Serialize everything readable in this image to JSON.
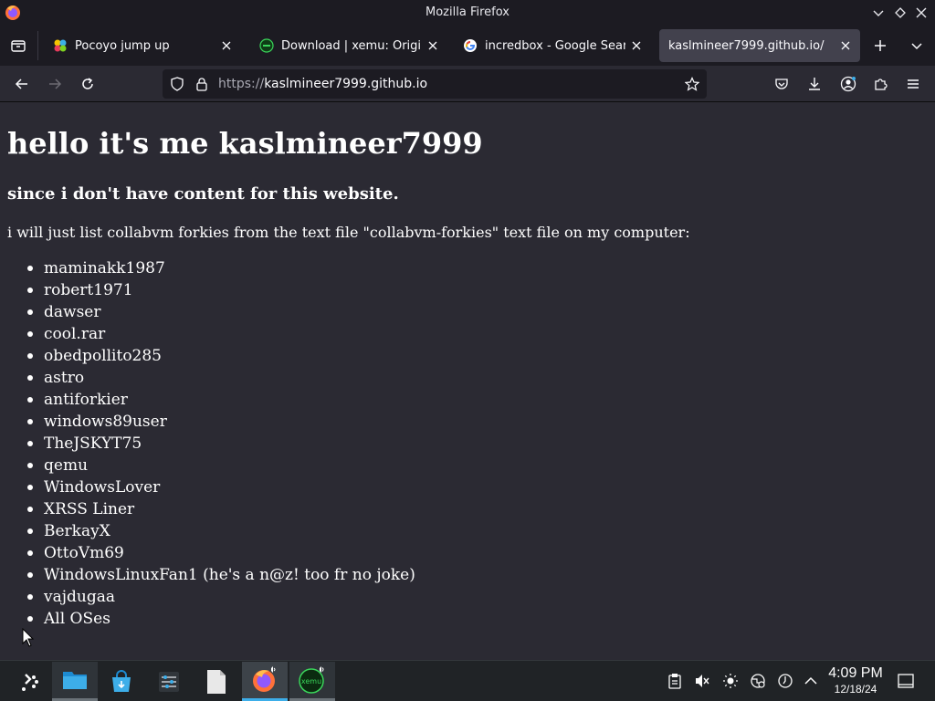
{
  "window": {
    "title": "Mozilla Firefox"
  },
  "tabs": [
    {
      "label": "Pocoyo jump up",
      "favicon": "pocoyo-favicon",
      "active": false
    },
    {
      "label": "Download | xemu: Original",
      "favicon": "xemu-favicon",
      "active": false
    },
    {
      "label": "incredbox - Google Search",
      "favicon": "google-favicon",
      "active": false
    },
    {
      "label": "kaslmineer7999.github.io/",
      "favicon": "none",
      "active": true
    }
  ],
  "urlbar": {
    "protocol": "https://",
    "host": "kaslmineer7999.github.io"
  },
  "page": {
    "heading": "hello it's me kaslmineer7999",
    "subheading": "since i don't have content for this website.",
    "intro": "i will just list collabvm forkies from the text file \"collabvm-forkies\" text file on my computer:",
    "forkies": [
      "maminakk1987",
      "robert1971",
      "dawser",
      "cool.rar",
      "obedpollito285",
      "astro",
      "antiforkier",
      "windows89user",
      "TheJSKYT75",
      "qemu",
      "WindowsLover",
      "XRSS Liner",
      "BerkayX",
      "OttoVm69",
      "WindowsLinuxFan1 (he's a n@z! too fr no joke)",
      "vajdugaa",
      "All OSes"
    ]
  },
  "taskbar": {
    "apps": [
      "app-launcher",
      "file-manager",
      "discover-store",
      "system-settings",
      "text-file",
      "firefox",
      "xemu"
    ],
    "clock": {
      "time": "4:09 PM",
      "date": "12/18/24"
    }
  },
  "colors": {
    "accent": "#3daee9",
    "page_background": "#2b2a33",
    "chrome_background": "#1c1b22",
    "active_tab": "#42414d"
  }
}
